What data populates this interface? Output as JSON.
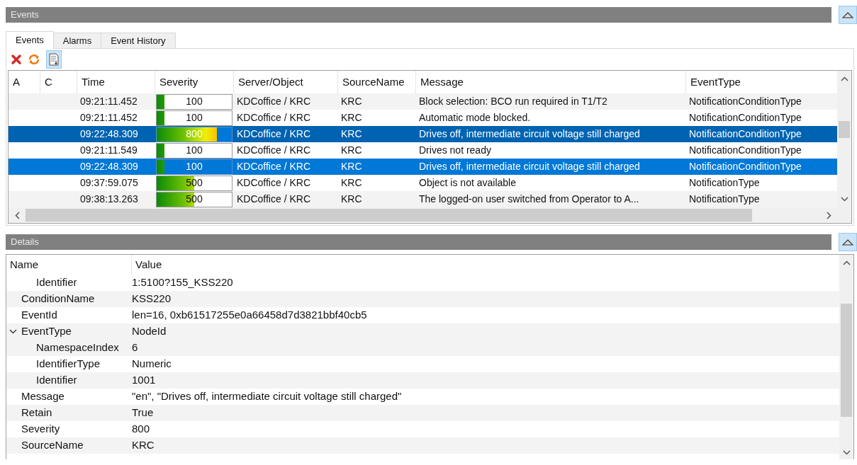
{
  "events_panel": {
    "title": "Events"
  },
  "tabs": [
    {
      "label": "Events",
      "selected": true
    },
    {
      "label": "Alarms",
      "selected": false
    },
    {
      "label": "Event History",
      "selected": false
    }
  ],
  "table": {
    "columns": [
      "A",
      "C",
      "Time",
      "Severity",
      "Server/Object",
      "SourceName",
      "Message",
      "EventType"
    ],
    "rows": [
      {
        "time": "09:21:11.452",
        "severity": "100",
        "level": 0.1,
        "server": "KDCoffice / KRC",
        "source": "KRC",
        "message": "Block selection: BCO run required in T1/T2",
        "event_type": "NotificationConditionType",
        "selected": false,
        "focused": false
      },
      {
        "time": "09:21:11.452",
        "severity": "100",
        "level": 0.1,
        "server": "KDCoffice / KRC",
        "source": "KRC",
        "message": "Automatic mode blocked.",
        "event_type": "NotificationConditionType",
        "selected": false,
        "focused": false
      },
      {
        "time": "09:22:48.309",
        "severity": "800",
        "level": 0.8,
        "server": "KDCoffice / KRC",
        "source": "KRC",
        "message": "Drives off, intermediate circuit voltage still charged",
        "event_type": "NotificationConditionType",
        "selected": true,
        "focused": true
      },
      {
        "time": "09:21:11.549",
        "severity": "100",
        "level": 0.1,
        "server": "KDCoffice / KRC",
        "source": "KRC",
        "message": "Drives not ready",
        "event_type": "NotificationConditionType",
        "selected": false,
        "focused": false
      },
      {
        "time": "09:22:48.309",
        "severity": "100",
        "level": 0.1,
        "server": "KDCoffice / KRC",
        "source": "KRC",
        "message": "Drives off, intermediate circuit voltage still charged",
        "event_type": "NotificationConditionType",
        "selected": true,
        "focused": false
      },
      {
        "time": "09:37:59.075",
        "severity": "500",
        "level": 0.5,
        "server": "KDCoffice / KRC",
        "source": "KRC",
        "message": "Object is not available",
        "event_type": "NotificationType",
        "selected": false,
        "focused": false
      },
      {
        "time": "09:38:13.263",
        "severity": "500",
        "level": 0.5,
        "server": "KDCoffice / KRC",
        "source": "KRC",
        "message": "The logged-on user switched from Operator to A...",
        "event_type": "NotificationType",
        "selected": false,
        "focused": false
      }
    ]
  },
  "details_panel": {
    "title": "Details"
  },
  "details": {
    "columns": [
      "Name",
      "Value"
    ],
    "rows": [
      {
        "children": [
          {
            "name": "Identifier",
            "value": "1:5100?155_KSS220"
          }
        ]
      },
      {
        "name": "ConditionName",
        "value": "KSS220"
      },
      {
        "name": "EventId",
        "value": "len=16, 0xb61517255e0a66458d7d3821bbf40cb5"
      },
      {
        "name": "EventType",
        "value": "NodeId",
        "expanded": true,
        "children": [
          {
            "name": "NamespaceIndex",
            "value": "6"
          },
          {
            "name": "IdentifierType",
            "value": "Numeric"
          },
          {
            "name": "Identifier",
            "value": "1001"
          }
        ]
      },
      {
        "name": "Message",
        "value": "\"en\", \"Drives off, intermediate circuit voltage still charged\""
      },
      {
        "name": "Retain",
        "value": "True"
      },
      {
        "name": "Severity",
        "value": "800"
      },
      {
        "name": "SourceName",
        "value": "KRC"
      }
    ]
  }
}
